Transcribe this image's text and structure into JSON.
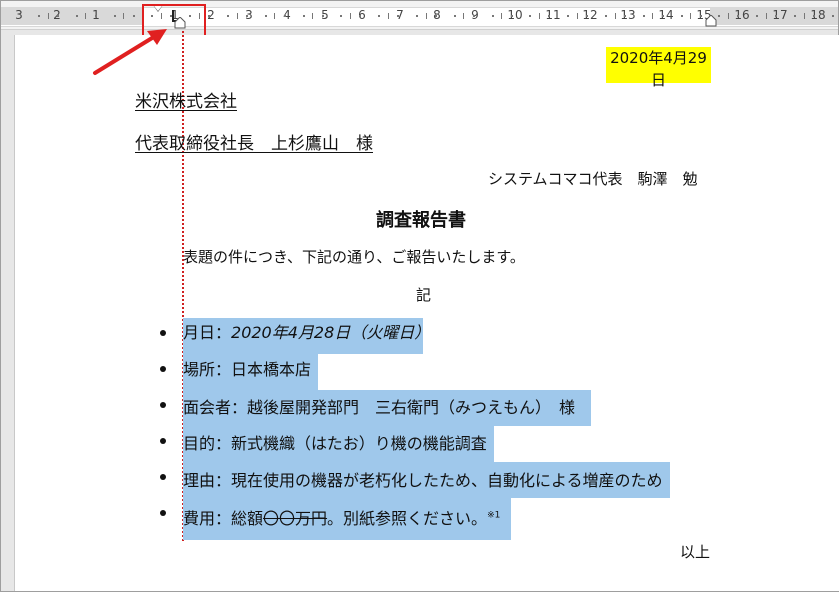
{
  "ruler": {
    "labels": [
      "3",
      "2",
      "1",
      "1",
      "2",
      "3",
      "4",
      "5",
      "6",
      "7",
      "8",
      "9",
      "10",
      "11",
      "12",
      "13",
      "14",
      "15",
      "16",
      "17",
      "18"
    ]
  },
  "document": {
    "date": "2020年4月29日",
    "recipient_company": "米沢株式会社",
    "recipient_person": "代表取締役社長　上杉鷹山　様",
    "sender": "システムコマコ代表　駒澤　勉",
    "title": "調査報告書",
    "intro": "表題の件につき、下記の通り、ご報告いたします。",
    "ki": "記",
    "items": [
      {
        "label": "月日：",
        "value": "2020年4月28日（火曜日）"
      },
      {
        "label": "場所：",
        "value": "日本橋本店"
      },
      {
        "label": "面会者：",
        "value": "越後屋開発部門　三右衛門（みつえもん）　様"
      },
      {
        "label": "目的：",
        "value": "新式機織（はたお）り機の機能調査"
      },
      {
        "label": "理由：",
        "value": "現在使用の機器が老朽化したため、自動化による増産のため"
      },
      {
        "label": "費用：",
        "value_pre": "総額",
        "value_strike": "〇〇万円",
        "value_post": "。別紙参照ください。",
        "note": "※1"
      }
    ],
    "closing": "以上"
  },
  "colors": {
    "highlight": "#ffff00",
    "selection": "#9fc8eb",
    "annotation": "#e02020"
  }
}
